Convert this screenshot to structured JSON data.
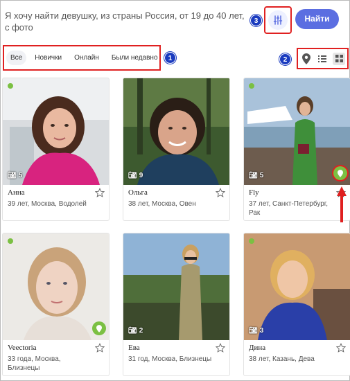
{
  "search": {
    "text": "Я хочу найти девушку, из страны Россия, от 19 до 40 лет, с фото",
    "find_label": "Найти"
  },
  "tabs": [
    {
      "label": "Все",
      "active": true
    },
    {
      "label": "Новички",
      "active": false
    },
    {
      "label": "Онлайн",
      "active": false
    },
    {
      "label": "Были недавно",
      "active": false
    }
  ],
  "badges": [
    "1",
    "2",
    "3"
  ],
  "view_icons": [
    "map-pin-icon",
    "list-view-icon",
    "grid-view-icon"
  ],
  "colors": {
    "accent": "#5b6ee1",
    "online": "#7bc043",
    "highlight": "#e02020",
    "badge": "#1a3bbf"
  },
  "cards": [
    {
      "name": "Анна",
      "info": "39 лет, Москва, Водолей",
      "photos": "5",
      "pin": false
    },
    {
      "name": "Ольга",
      "info": "38 лет, Москва, Овен",
      "photos": "9",
      "pin": false
    },
    {
      "name": "Fly",
      "info": "37 лет, Санкт-Петербург, Рак",
      "photos": "5",
      "pin": true
    },
    {
      "name": "Veectoria",
      "info": "33 года, Москва, Близнецы",
      "photos": "",
      "pin": true
    },
    {
      "name": "Ева",
      "info": "31 год, Москва, Близнецы",
      "photos": "2",
      "pin": false
    },
    {
      "name": "Дина",
      "info": "38 лет, Казань, Дева",
      "photos": "3",
      "pin": false
    }
  ]
}
